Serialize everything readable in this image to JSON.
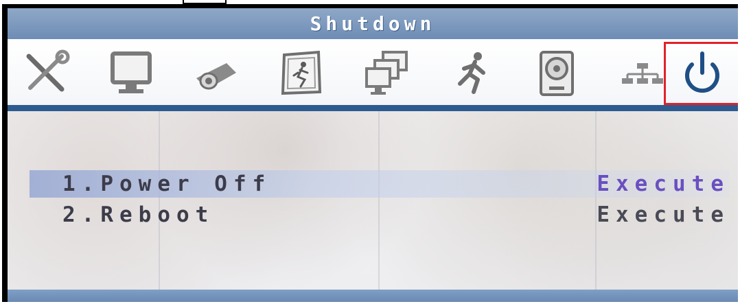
{
  "window": {
    "title": "Shutdown"
  },
  "toolbar": {
    "icons": [
      {
        "name": "tools-icon"
      },
      {
        "name": "monitor-icon"
      },
      {
        "name": "camera-icon"
      },
      {
        "name": "motion-detection-icon"
      },
      {
        "name": "multi-screen-icon"
      },
      {
        "name": "running-man-icon"
      },
      {
        "name": "hard-disk-icon"
      },
      {
        "name": "network-icon"
      },
      {
        "name": "power-icon",
        "selected": true
      }
    ]
  },
  "menu": {
    "items": [
      {
        "label": "1.Power Off",
        "action": "Execute",
        "highlighted": true
      },
      {
        "label": "2.Reboot",
        "action": "Execute",
        "highlighted": false
      }
    ]
  },
  "colors": {
    "title_bar": "#7a96bd",
    "rule": "#2d5b8f",
    "highlight": "#8ca0d2",
    "selection_border": "#e3202a",
    "active_action": "#6a4fc0"
  }
}
